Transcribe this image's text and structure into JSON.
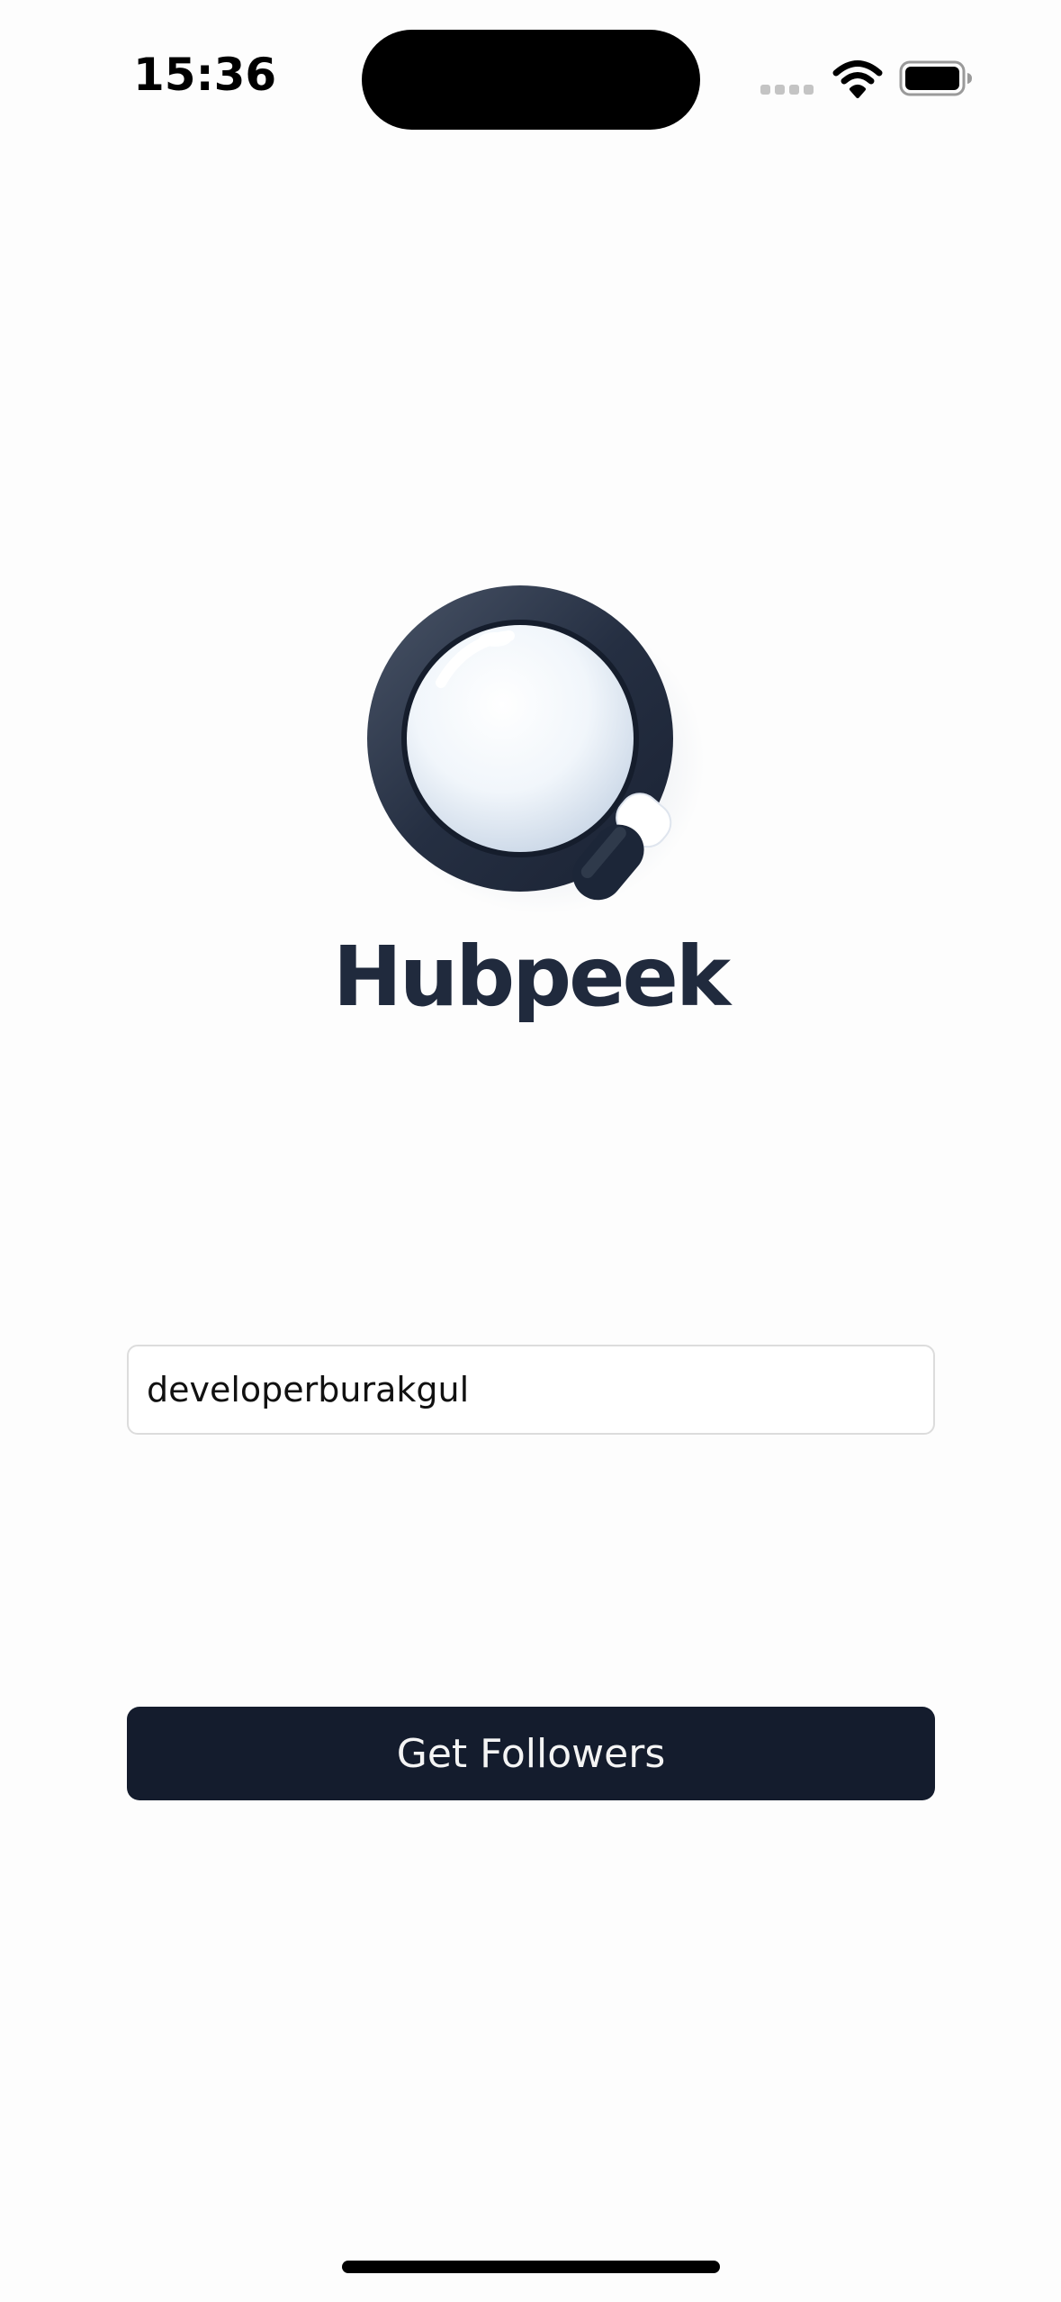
{
  "status_bar": {
    "time": "15:36",
    "icons": [
      "cellular-signal-icon",
      "wifi-icon",
      "battery-icon"
    ]
  },
  "logo": {
    "icon": "magnifying-glass-icon",
    "brand_name": "Hubpeek"
  },
  "form": {
    "username_value": "developerburakgul",
    "submit_label": "Get Followers"
  },
  "colors": {
    "background": "#fdfdfd",
    "brand_navy": "#202a3d",
    "button_background": "#141c2d",
    "button_text": "#f4f4f4",
    "input_border": "#dcdcdc"
  }
}
